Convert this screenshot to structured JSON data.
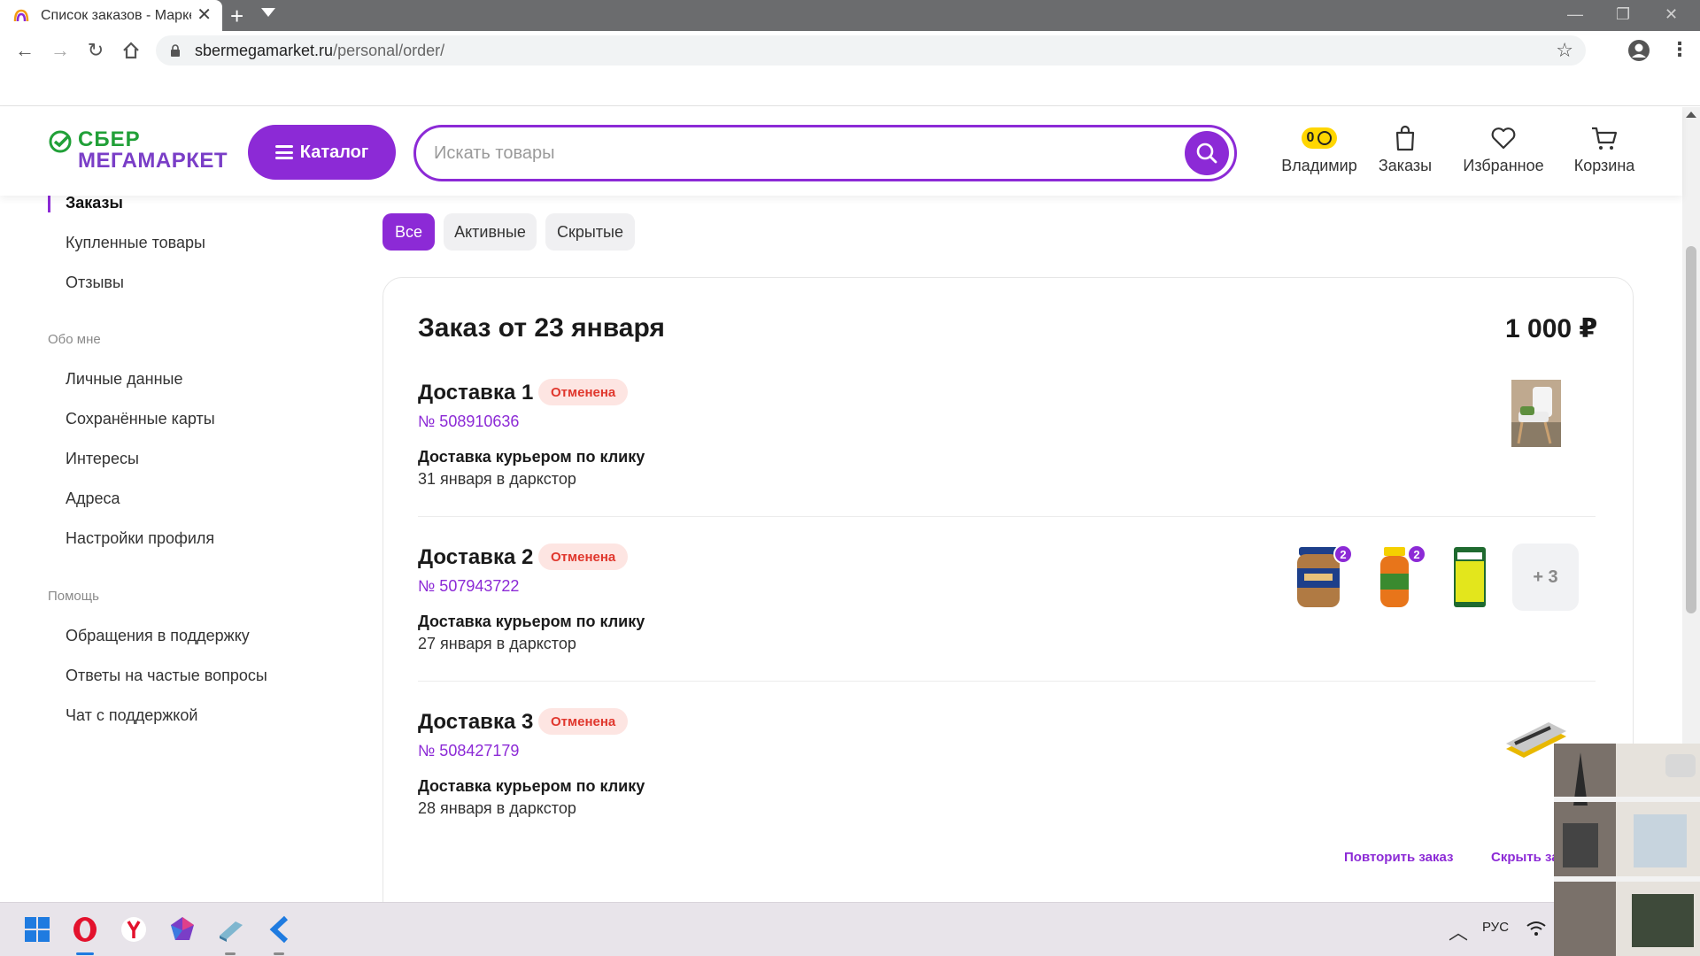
{
  "browser": {
    "tab_title": "Список заказов - Марке",
    "url_host": "sbermegamarket.ru",
    "url_path": "/personal/order/"
  },
  "header": {
    "logo_line1": "СБЕР",
    "logo_line2": "МЕГАМАРКЕТ",
    "catalog_label": "Каталог",
    "search_placeholder": "Искать товары",
    "bonus_value": "0",
    "profile_label": "Владимир",
    "orders_label": "Заказы",
    "favorites_label": "Избранное",
    "cart_label": "Корзина"
  },
  "sidebar": {
    "active_item": "Заказы",
    "items_top": [
      "Купленные товары",
      "Отзывы"
    ],
    "section_about": "Обо мне",
    "items_about": [
      "Личные данные",
      "Сохранённые карты",
      "Интересы",
      "Адреса",
      "Настройки профиля"
    ],
    "section_help": "Помощь",
    "items_help": [
      "Обращения в поддержку",
      "Ответы на частые вопросы",
      "Чат с поддержкой"
    ]
  },
  "filters": [
    "Все",
    "Активные",
    "Скрытые"
  ],
  "order": {
    "title": "Заказ от 23 января",
    "total": "1 000 ₽",
    "deliveries": [
      {
        "title": "Доставка 1",
        "status": "Отменена",
        "number": "№ 508910636",
        "method": "Доставка курьером по клику",
        "date": "31 января в даркстор"
      },
      {
        "title": "Доставка 2",
        "status": "Отменена",
        "number": "№ 507943722",
        "method": "Доставка курьером по клику",
        "date": "27 января в даркстор",
        "qty_badges": [
          "2",
          "2"
        ],
        "more": "+ 3"
      },
      {
        "title": "Доставка 3",
        "status": "Отменена",
        "number": "№ 508427179",
        "method": "Доставка курьером по клику",
        "date": "28 января в даркстор"
      }
    ],
    "actions": {
      "repeat": "Повторить заказ",
      "hide": "Скрыть заказ"
    }
  },
  "taskbar": {
    "lang": "РУС"
  },
  "colors": {
    "accent": "#8c2ad6",
    "green": "#21a038",
    "status_red": "#e0372d",
    "status_bg": "#fde5e2"
  }
}
